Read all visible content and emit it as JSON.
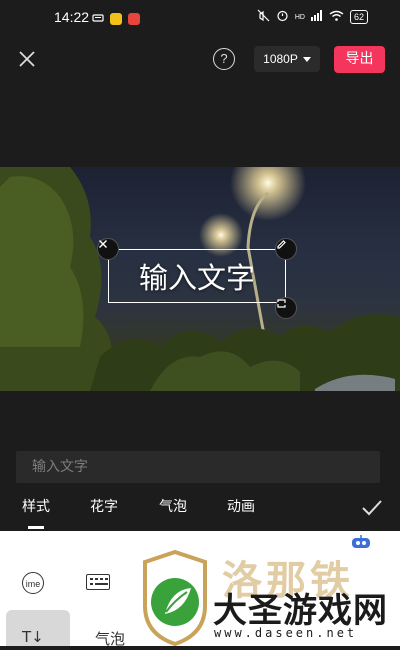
{
  "status_bar": {
    "time": "14:22",
    "signal_label": "HD",
    "battery": "62"
  },
  "toolbar": {
    "resolution": "1080P",
    "export_label": "导出",
    "help_symbol": "?"
  },
  "preview": {
    "overlay_text": "输入文字"
  },
  "text_input": {
    "placeholder": "输入文字"
  },
  "tabs": [
    {
      "label": "样式",
      "active": true
    },
    {
      "label": "花字",
      "active": false
    },
    {
      "label": "气泡",
      "active": false
    },
    {
      "label": "动画",
      "active": false
    }
  ],
  "keyboard": {
    "ime_label": "ime",
    "key1_label": "T↓",
    "key2_label": "气泡"
  },
  "watermark": {
    "title": "大圣游戏网",
    "url": "www.daseen.net",
    "partial_text": "洛那铁"
  },
  "colors": {
    "accent": "#f4355d",
    "background": "#1c1c1c",
    "input_bg": "#2a2a2a",
    "watermark_green": "#3aa23b",
    "watermark_gold": "#c9a35a"
  }
}
